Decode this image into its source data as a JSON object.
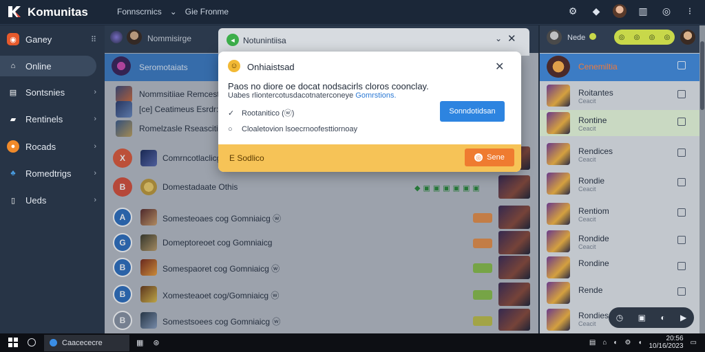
{
  "app": {
    "title": "Komunitas"
  },
  "top_menu": {
    "item1": "Fonnscrnics",
    "item2": "Gie Fronme"
  },
  "sidebar": {
    "items": [
      {
        "label": "Ganey",
        "color": "#e65a2c",
        "icon": "controller-icon"
      },
      {
        "label": "Online",
        "color": "#dfe4ea",
        "icon": "home-icon"
      },
      {
        "label": "Sontsnies",
        "color": "#dfe4ea",
        "icon": "chat-icon"
      },
      {
        "label": "Rentinels",
        "color": "#dfe4ea",
        "icon": "car-icon"
      },
      {
        "label": "Rocads",
        "color": "#f08a2a",
        "icon": "coin-icon"
      },
      {
        "label": "Romedtrigs",
        "color": "#4aa0e6",
        "icon": "people-icon"
      },
      {
        "label": "Ueds",
        "color": "#dfe4ea",
        "icon": "book-icon"
      }
    ]
  },
  "main": {
    "header_label": "Nommisirge",
    "band_label": "Seromotaiats",
    "rows": [
      {
        "text": "Nommsitiiae Remcestetir",
        "circ": "",
        "circ_color": "transparent"
      },
      {
        "text": "[ce] Ceatimeus Esrdr:ilgr",
        "circ": "",
        "circ_color": "transparent"
      },
      {
        "text": "Romelzasle Rseascitie",
        "circ": "",
        "circ_color": "transparent"
      },
      {
        "text": "Comrncotlaclicgsa|Se",
        "circ": "X",
        "circ_color": "#e05a3a"
      },
      {
        "text": "Domestadaate Othis",
        "circ": "B",
        "circ_color": "#d8503a"
      },
      {
        "text": "Somesteoaes cog Gomniaicg ⓦ",
        "circ": "A",
        "circ_color": "#2e6fc0"
      },
      {
        "text": "Domeptoreoet cog Gomniaicg",
        "circ": "G",
        "circ_color": "#2e6fc0"
      },
      {
        "text": "Somespaoret cog Gomniaicg ⓦ",
        "circ": "B",
        "circ_color": "#2e6fc0"
      },
      {
        "text": "Xomesteaoet cog/Gomniaicg ⓦ",
        "circ": "B",
        "circ_color": "#2e6fc0"
      },
      {
        "text": "Somestsoees cog Gomniaicg ⓦ",
        "circ": "B",
        "circ_color": "#2e6fc0"
      }
    ]
  },
  "right_panel": {
    "header_label": "Nede",
    "band_label": "Cenemiltia",
    "items": [
      {
        "label": "Roitantes",
        "sub": "Ceacit"
      },
      {
        "label": "Rontine",
        "sub": "Ceacit"
      },
      {
        "label": "Rendices",
        "sub": "Ceacit"
      },
      {
        "label": "Rondie",
        "sub": "Ceacit"
      },
      {
        "label": "Rentiom",
        "sub": "Ceacit"
      },
      {
        "label": "Rondide",
        "sub": "Ceacit"
      },
      {
        "label": "Rondine",
        "sub": ""
      },
      {
        "label": "Rende",
        "sub": ""
      },
      {
        "label": "Rondies",
        "sub": "Ceacit"
      }
    ]
  },
  "notification": {
    "title": "Notunintiisa",
    "minimize": "⌄",
    "close": "✕"
  },
  "dialog": {
    "title": "Onhiaistsad",
    "message": "Paos no diore oe docat nodsacirls cloros coonclay.",
    "sub_text": "Uabes rliontercotusdacotnaterconeye",
    "sub_link": "Gomrstions.",
    "option1": "Rootanitico (ⓦ)",
    "option2": "Cloaletovion lsoecrnoofesttiornoay",
    "primary_button": "Sonndotidsan",
    "footer_label": "E Sodlico",
    "footer_button": "Sene"
  },
  "taskbar": {
    "search": "Caacececre",
    "clock_time": "20:56",
    "clock_date": "10/16/2023",
    "colors": {
      "accent": "#2d84e0",
      "warning": "#f6c357"
    }
  }
}
